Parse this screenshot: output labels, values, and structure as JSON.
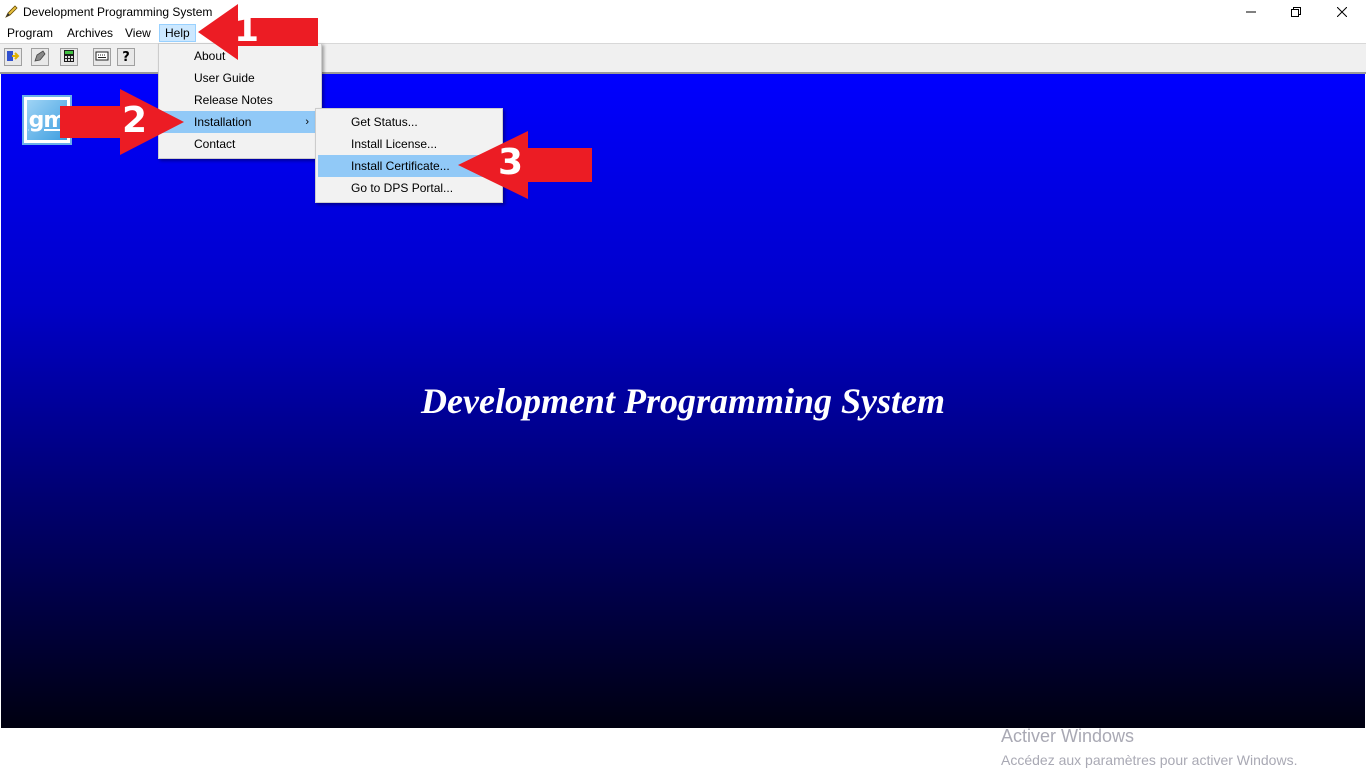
{
  "window": {
    "title": "Development Programming System"
  },
  "menubar": {
    "items": [
      "Program",
      "Archives",
      "View",
      "Help"
    ]
  },
  "toolbar": {
    "buttons": [
      "import-icon",
      "edit-icon",
      "calculator-icon",
      "keyboard-icon",
      "help-icon"
    ]
  },
  "help_menu": {
    "items": [
      "About",
      "User Guide",
      "Release Notes",
      "Installation",
      "Contact"
    ],
    "highlighted": "Installation"
  },
  "installation_menu": {
    "items": [
      "Get Status...",
      "Install License...",
      "Install Certificate...",
      "Go to DPS Portal..."
    ],
    "highlighted": "Install Certificate..."
  },
  "main": {
    "title": "Development Programming System",
    "logo_text": "gm"
  },
  "annotations": {
    "step1": "1",
    "step2": "2",
    "step3": "3"
  },
  "watermark": {
    "title": "Activer Windows",
    "subtitle": "Accédez aux paramètres pour activer Windows."
  },
  "colors": {
    "main_top": "#0000ff",
    "main_bottom": "#000010",
    "menu_highlight": "#91c9f7",
    "arrow_red": "#ec1c24"
  }
}
